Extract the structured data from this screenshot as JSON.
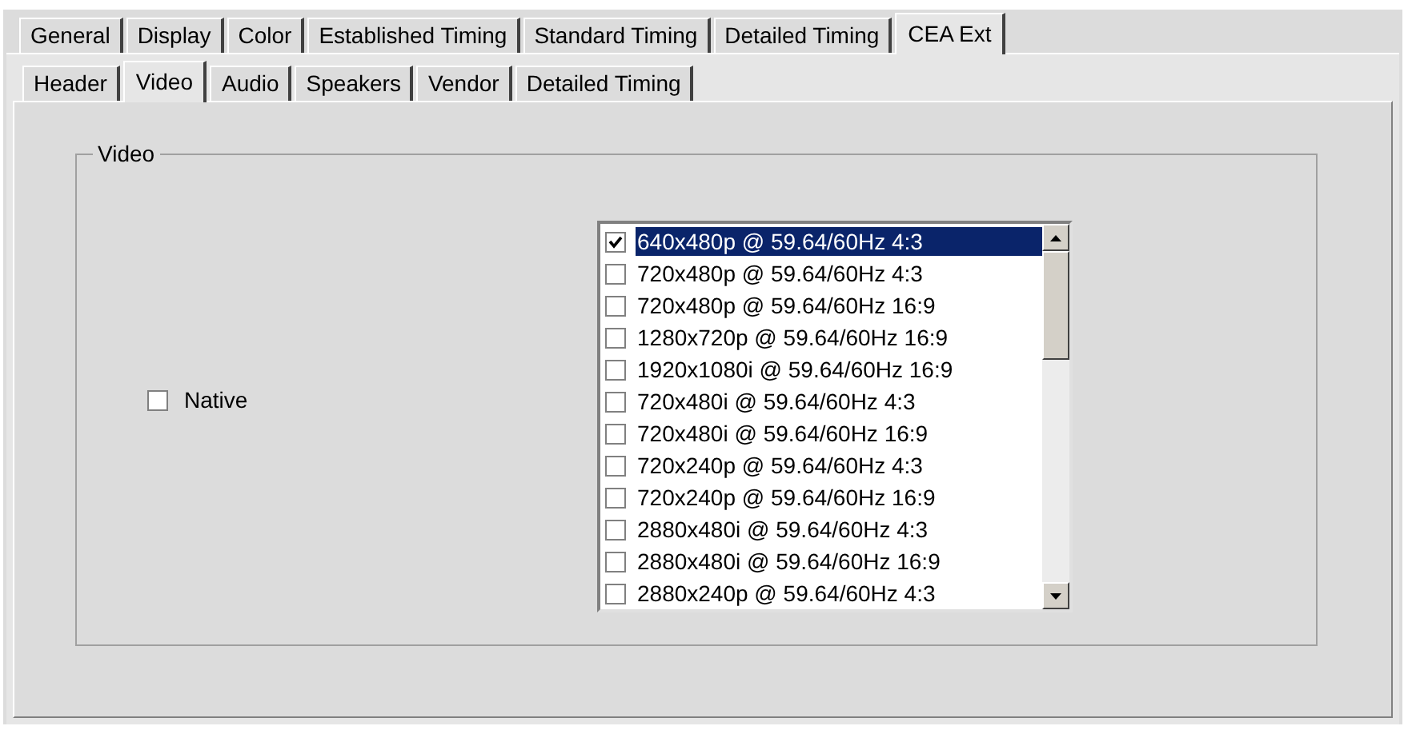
{
  "tabs": [
    {
      "label": "General",
      "selected": false
    },
    {
      "label": "Display",
      "selected": false
    },
    {
      "label": "Color",
      "selected": false
    },
    {
      "label": "Established Timing",
      "selected": false
    },
    {
      "label": "Standard Timing",
      "selected": false
    },
    {
      "label": "Detailed Timing",
      "selected": false
    },
    {
      "label": "CEA Ext",
      "selected": true
    }
  ],
  "subtabs": [
    {
      "label": "Header",
      "selected": false
    },
    {
      "label": "Video",
      "selected": true
    },
    {
      "label": "Audio",
      "selected": false
    },
    {
      "label": "Speakers",
      "selected": false
    },
    {
      "label": "Vendor",
      "selected": false
    },
    {
      "label": "Detailed Timing",
      "selected": false
    }
  ],
  "group": {
    "title": "Video",
    "native": {
      "label": "Native",
      "checked": false
    },
    "modes": [
      {
        "label": "640x480p @ 59.64/60Hz 4:3",
        "checked": true,
        "selected": true
      },
      {
        "label": "720x480p @ 59.64/60Hz 4:3",
        "checked": false,
        "selected": false
      },
      {
        "label": "720x480p @ 59.64/60Hz 16:9",
        "checked": false,
        "selected": false
      },
      {
        "label": "1280x720p @ 59.64/60Hz 16:9",
        "checked": false,
        "selected": false
      },
      {
        "label": "1920x1080i @ 59.64/60Hz 16:9",
        "checked": false,
        "selected": false
      },
      {
        "label": "720x480i @ 59.64/60Hz 4:3",
        "checked": false,
        "selected": false
      },
      {
        "label": "720x480i @ 59.64/60Hz 16:9",
        "checked": false,
        "selected": false
      },
      {
        "label": "720x240p @ 59.64/60Hz 4:3",
        "checked": false,
        "selected": false
      },
      {
        "label": "720x240p @ 59.64/60Hz 16:9",
        "checked": false,
        "selected": false
      },
      {
        "label": "2880x480i @ 59.64/60Hz 4:3",
        "checked": false,
        "selected": false
      },
      {
        "label": "2880x480i @ 59.64/60Hz 16:9",
        "checked": false,
        "selected": false
      },
      {
        "label": "2880x240p @ 59.64/60Hz 4:3",
        "checked": false,
        "selected": false
      }
    ]
  }
}
